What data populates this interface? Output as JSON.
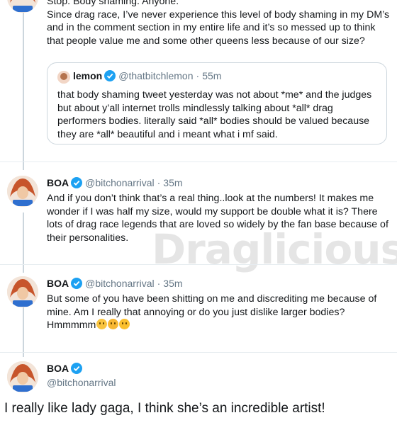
{
  "tweet1": {
    "text_lines": [
      "Stop. Body shaming. Anyone.",
      "Since drag race, I’ve never experience this level of body shaming in my DM’s and in the comment section in my entire life and it’s so messed up to think that people value me and some other queens less because of our size?"
    ],
    "quote": {
      "name": "lemon",
      "handle": "@thatbitchlemon",
      "dot": "·",
      "time": "55m",
      "text": "that body shaming tweet yesterday was not about *me* and the judges but about y’all internet trolls mindlessly talking about *all* drag performers bodies. literally said *all* bodies should be valued because they are *all* beautiful and i meant what i mf said."
    }
  },
  "tweet2": {
    "name": "BOA",
    "handle": "@bitchonarrival",
    "dot": "·",
    "time": "35m",
    "text": "And if you don’t think that’s a real thing..look at the numbers! It makes me wonder if I was half my size, would my support be double  what it is? There lots of drag race legends that are loved so widely by the fan base because of their personalities."
  },
  "tweet3": {
    "name": "BOA",
    "handle": "@bitchonarrival",
    "dot": "·",
    "time": "35m",
    "text": "But some of you have been shitting on me and discrediting me because of mine. Am I really that annoying or do you just dislike larger bodies?",
    "text_end": "Hmmmmm"
  },
  "tweet4": {
    "name": "BOA",
    "handle": "@bitchonarrival"
  },
  "caption": "I really like lady gaga, I think she’s an incredible artist!",
  "watermark": "Draglicious",
  "icons": {
    "verified": "verified-badge-icon",
    "emoji": [
      "worried-face-emoji",
      "hugging-face-emoji",
      "thinking-face-emoji"
    ]
  },
  "colors": {
    "verified": "#1da1f2",
    "secondary_text": "#657786",
    "thread_line": "#ccd6dd"
  }
}
